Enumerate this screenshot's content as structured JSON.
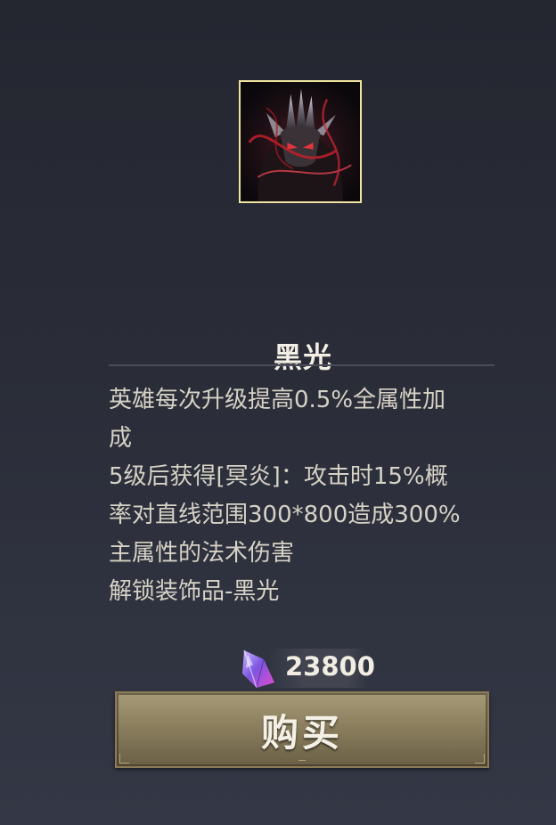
{
  "item": {
    "name": "黑光",
    "icon": "dark-armored-champion-portrait",
    "frame_color": "#efe3a0",
    "description_lines": [
      "英雄每次升级提高0.5%全属性加",
      "成",
      "5级后获得[冥炎]：攻击时15%概",
      "率对直线范围300*800造成300%",
      "主属性的法术伤害",
      "解锁装饰品-黑光"
    ]
  },
  "price": {
    "currency_icon": "purple-crystal-icon",
    "amount": "23800"
  },
  "buy_button": {
    "label": "购买"
  }
}
